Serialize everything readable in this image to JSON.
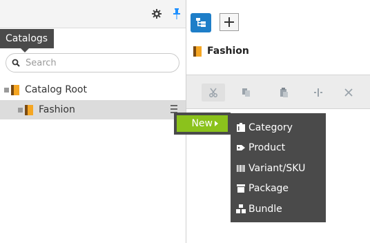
{
  "left_panel": {
    "tab_label": "Catalogs",
    "search_placeholder": "Search",
    "tree": [
      {
        "label": "Catalog Root"
      },
      {
        "label": "Fashion"
      }
    ]
  },
  "right_panel": {
    "title": "Fashion"
  },
  "context_menu": {
    "new_label": "New",
    "items": [
      {
        "label": "Category",
        "icon": "category-icon"
      },
      {
        "label": "Product",
        "icon": "product-icon"
      },
      {
        "label": "Variant/SKU",
        "icon": "variant-sku-icon"
      },
      {
        "label": "Package",
        "icon": "package-icon"
      },
      {
        "label": "Bundle",
        "icon": "bundle-icon"
      }
    ]
  },
  "colors": {
    "accent_green": "#8bc21c",
    "accent_blue": "#1e7ec8",
    "menu_bg": "#4a4a4a",
    "folder_orange": "#f5a623"
  }
}
